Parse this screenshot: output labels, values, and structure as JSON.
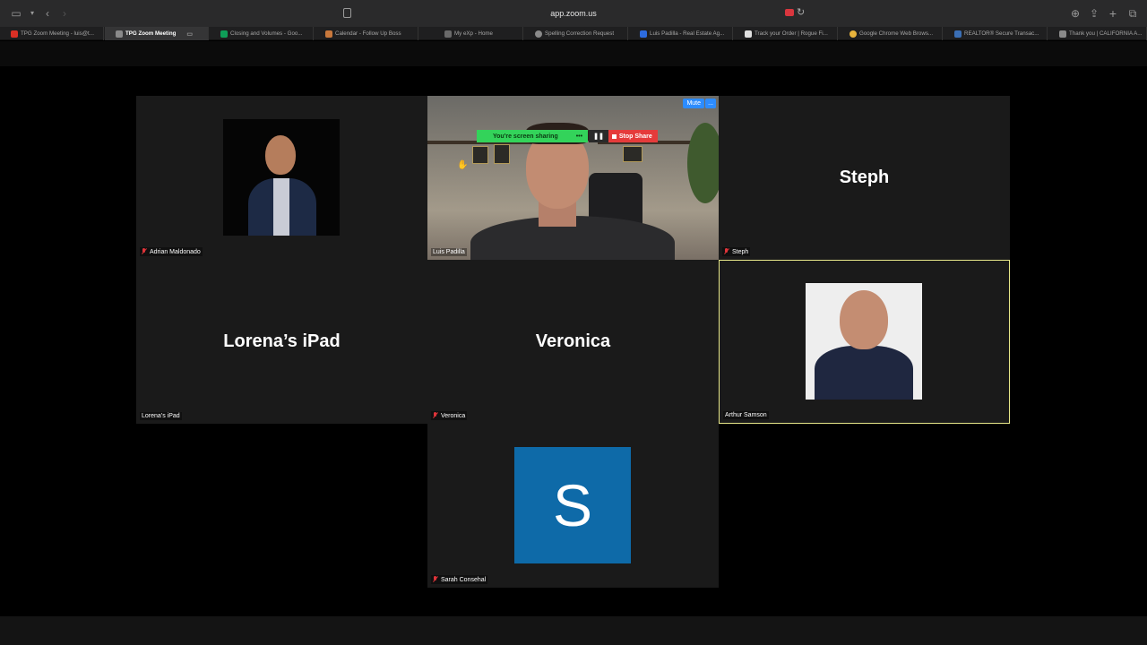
{
  "browser": {
    "url": "app.zoom.us",
    "tabs": [
      {
        "label": "TPG Zoom Meeting - luis@t...",
        "active": false,
        "color": "#d93025"
      },
      {
        "label": "TPG Zoom Meeting",
        "active": true,
        "color": "#8a8a8a"
      },
      {
        "label": "Closing and Volumes - Goo...",
        "active": false,
        "color": "#0f9d58"
      },
      {
        "label": "Calendar - Follow Up Boss",
        "active": false,
        "color": "#c8783c"
      },
      {
        "label": "My eXp - Home",
        "active": false,
        "color": "#6a6a6a"
      },
      {
        "label": "Spelling Correction Request",
        "active": false,
        "color": "#8a8a8a"
      },
      {
        "label": "Luis Padilla - Real Estate Ag...",
        "active": false,
        "color": "#2d6cdf"
      },
      {
        "label": "Track your Order | Rogue Fi...",
        "active": false,
        "color": "#e0e0e0"
      },
      {
        "label": "Google Chrome Web Brows...",
        "active": false,
        "color": "#e8b33c"
      },
      {
        "label": "REALTOR® Secure Transac...",
        "active": false,
        "color": "#3b6fb5"
      },
      {
        "label": "Thank you | CALIFORNIA A...",
        "active": false,
        "color": "#8a8a8a"
      }
    ]
  },
  "participants": {
    "adrian": {
      "name": "Adrian Maldonado",
      "muted": true
    },
    "luis": {
      "name": "Luis Padilla",
      "muted": false
    },
    "steph": {
      "name": "Steph",
      "display": "Steph",
      "muted": true
    },
    "lorena": {
      "name": "Lorena’s iPad",
      "display": "Lorena’s iPad",
      "muted": false
    },
    "veronica": {
      "name": "Veronica",
      "display": "Veronica",
      "muted": true
    },
    "arthur": {
      "name": "Arthur Samson",
      "muted": false
    },
    "sarah": {
      "name": "Sarah Consehal",
      "initial": "S",
      "muted": true
    }
  },
  "screen_share": {
    "status": "You're screen sharing",
    "dots": "•••",
    "pause": "❚❚",
    "stop_label": "Stop Share"
  },
  "video_controls": {
    "mute_label": "Mute",
    "more_label": "..."
  },
  "colors": {
    "stop_share": "#e53b3b",
    "sharing_green": "#33d35a",
    "active_speaker_border": "#e8e88a",
    "avatar_blue": "#0e6aa8"
  }
}
